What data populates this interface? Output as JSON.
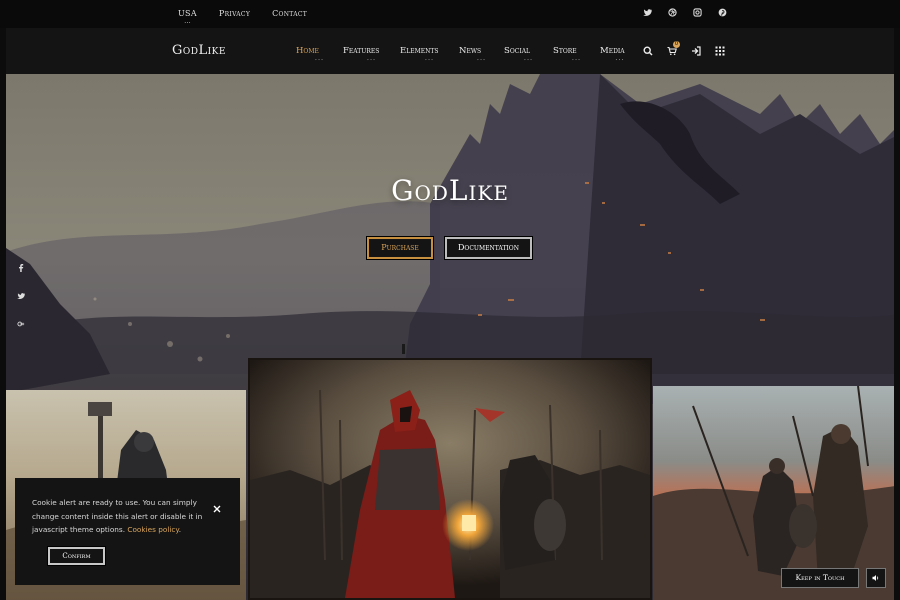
{
  "topbar": {
    "links": [
      "USA",
      "Privacy",
      "Contact"
    ],
    "social_icons": [
      "twitter-icon",
      "dribbble-icon",
      "instagram-icon",
      "pinterest-icon"
    ]
  },
  "nav": {
    "logo": "GodLike",
    "menu": [
      "Home",
      "Features",
      "Elements",
      "News",
      "Social",
      "Store",
      "Media"
    ],
    "active": "Home",
    "icons": [
      "search-icon",
      "cart-icon",
      "sign-in-icon",
      "grid-menu-icon"
    ],
    "cart_count": "0"
  },
  "hero": {
    "title": "GodLike",
    "purchase_label": "Purchase",
    "docs_label": "Documentation",
    "side_social": [
      "facebook-icon",
      "twitter-icon",
      "google-plus-icon"
    ]
  },
  "cookie": {
    "text": "Cookie alert are ready to use. You can simply change content inside this alert or disable it in javascript theme options.",
    "link": "Cookies policy",
    "confirm_label": "Confirm"
  },
  "footer": {
    "keep_label": "Keep in Touch"
  },
  "colors": {
    "accent": "#d9a55a",
    "dark": "#141414",
    "topbar": "#0a0a0a"
  }
}
